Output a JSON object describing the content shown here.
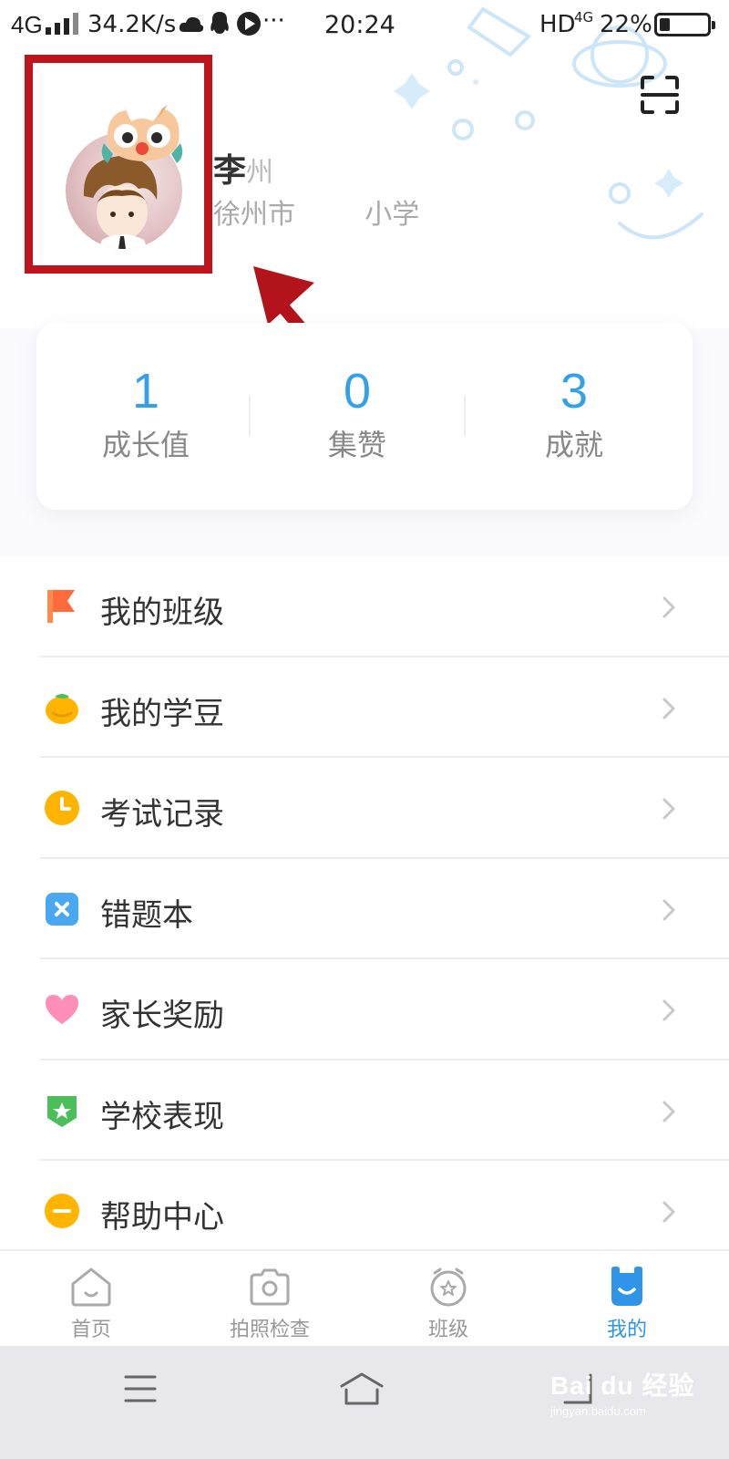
{
  "status_bar": {
    "network": "4G",
    "speed": "34.2K/s",
    "more": "···",
    "time": "20:24",
    "hd": "HD",
    "network_right": "4G",
    "battery": "22%",
    "battery_level": 0.22
  },
  "profile": {
    "name_first": "李",
    "name_rest": "州",
    "school": "徐州市        小学"
  },
  "stats": [
    {
      "value": "1",
      "label": "成长值"
    },
    {
      "value": "0",
      "label": "集赞"
    },
    {
      "value": "3",
      "label": "成就"
    }
  ],
  "menu": [
    {
      "label": "我的班级",
      "icon": "flag-icon",
      "color": "#ff6b3d"
    },
    {
      "label": "我的学豆",
      "icon": "bean-icon",
      "color": "#ffb400"
    },
    {
      "label": "考试记录",
      "icon": "clock-icon",
      "color": "#ffb400"
    },
    {
      "label": "错题本",
      "icon": "mistake-book-icon",
      "color": "#4aa8f0"
    },
    {
      "label": "家长奖励",
      "icon": "heart-icon",
      "color": "#ff8fb8"
    },
    {
      "label": "学校表现",
      "icon": "shield-star-icon",
      "color": "#4cbf5b"
    },
    {
      "label": "帮助中心",
      "icon": "help-icon",
      "color": "#ffb400"
    }
  ],
  "tabs": [
    {
      "label": "首页",
      "icon": "home-icon",
      "active": false
    },
    {
      "label": "拍照检查",
      "icon": "camera-icon",
      "active": false
    },
    {
      "label": "班级",
      "icon": "class-clock-icon",
      "active": false
    },
    {
      "label": "我的",
      "icon": "me-icon",
      "active": true
    }
  ],
  "colors": {
    "accent": "#33a1e8",
    "tab_active": "#2e95e8",
    "annotation_red": "#c0141c"
  },
  "watermark": {
    "brand": "Bai du 经验",
    "url": "jingyan.baidu.com"
  }
}
